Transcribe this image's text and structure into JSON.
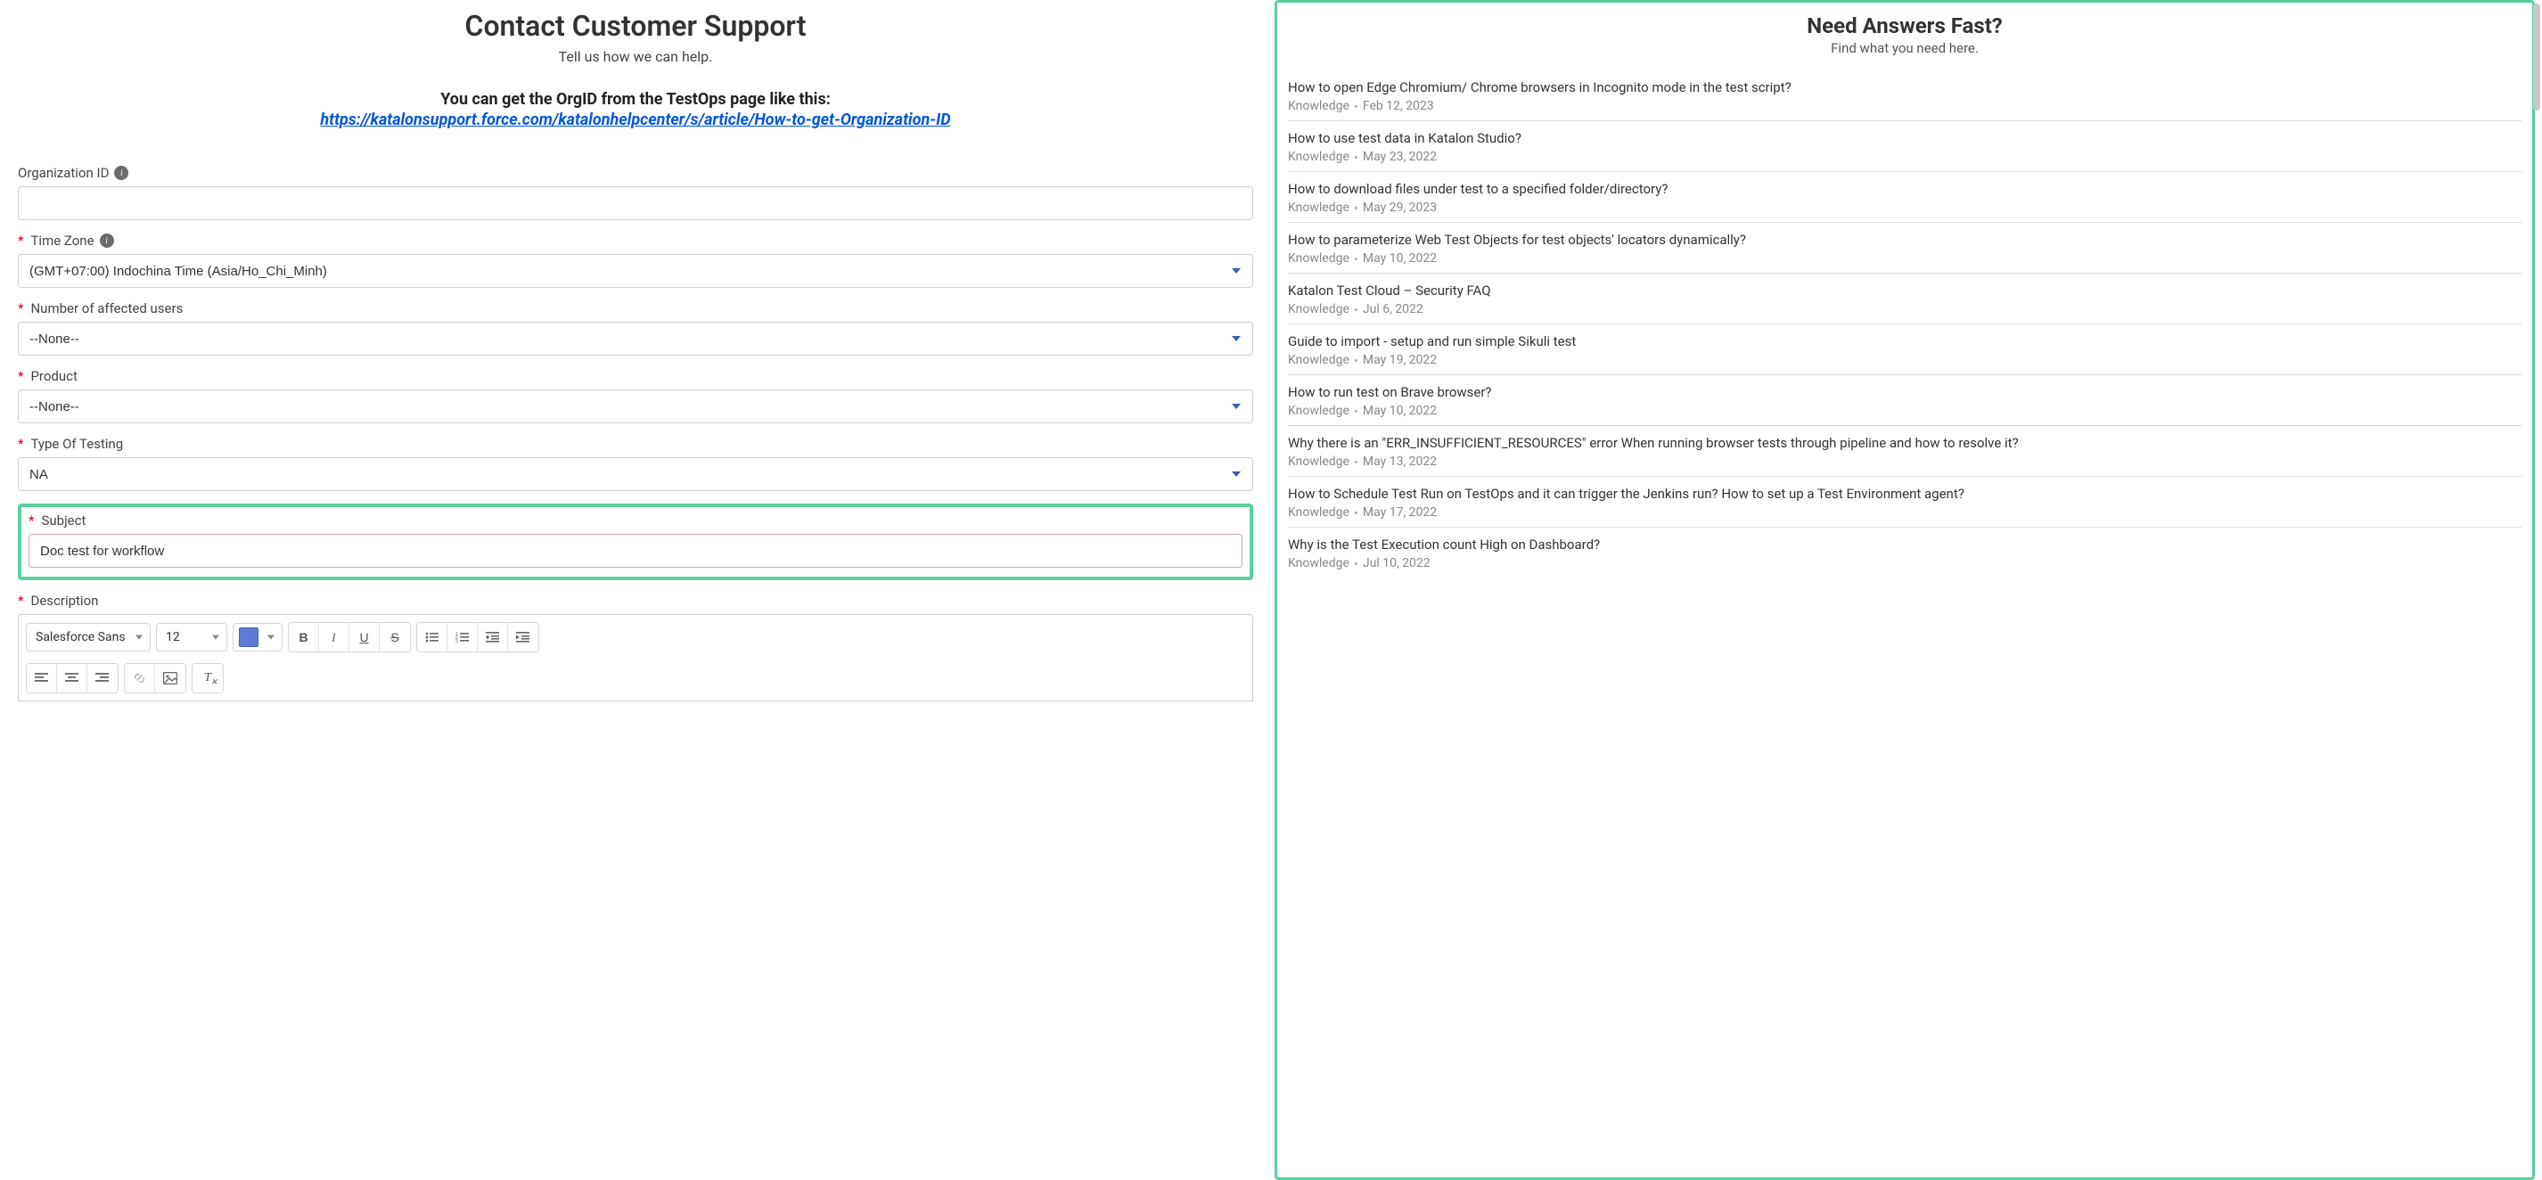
{
  "header": {
    "title": "Contact Customer Support",
    "subtitle": "Tell us how we can help.",
    "org_help_text": "You can get the OrgID from the TestOps page like this:",
    "org_link_text": "https://katalonsupport.force.com/katalonhelpcenter/s/article/How-to-get-Organization-ID"
  },
  "form": {
    "org_id": {
      "label": "Organization ID",
      "value": ""
    },
    "timezone": {
      "label": "Time Zone",
      "value": "(GMT+07:00) Indochina Time (Asia/Ho_Chi_Minh)"
    },
    "affected_users": {
      "label": "Number of affected users",
      "value": "--None--"
    },
    "product": {
      "label": "Product",
      "value": "--None--"
    },
    "type_of_testing": {
      "label": "Type Of Testing",
      "value": "NA"
    },
    "subject": {
      "label": "Subject",
      "value": "Doc test for workflow"
    },
    "description": {
      "label": "Description"
    }
  },
  "toolbar": {
    "font_family": "Salesforce Sans",
    "font_size": "12",
    "text_color": "#5d7bd6"
  },
  "answers": {
    "title": "Need Answers Fast?",
    "subtitle": "Find what you need here.",
    "category_label": "Knowledge",
    "articles": [
      {
        "title": "How to open Edge Chromium/ Chrome browsers in Incognito mode in the test script?",
        "date": "Feb 12, 2023"
      },
      {
        "title": "How to use test data in Katalon Studio?",
        "date": "May 23, 2022"
      },
      {
        "title": "How to download files under test to a specified folder/directory?",
        "date": "May 29, 2023"
      },
      {
        "title": "How to parameterize Web Test Objects for test objects' locators dynamically?",
        "date": "May 10, 2022"
      },
      {
        "title": "Katalon Test Cloud – Security FAQ",
        "date": "Jul 6, 2022"
      },
      {
        "title": "Guide to import - setup and run simple Sikuli test",
        "date": "May 19, 2022"
      },
      {
        "title": "How to run test on Brave browser?",
        "date": "May 10, 2022"
      },
      {
        "title": "Why there is an \"ERR_INSUFFICIENT_RESOURCES\" error When running browser tests through pipeline and how to resolve it?",
        "date": "May 13, 2022"
      },
      {
        "title": "How to Schedule Test Run on TestOps and it can trigger the Jenkins run? How to set up a Test Environment agent?",
        "date": "May 17, 2022"
      },
      {
        "title": "Why is the Test Execution count High on Dashboard?",
        "date": "Jul 10, 2022"
      }
    ]
  }
}
